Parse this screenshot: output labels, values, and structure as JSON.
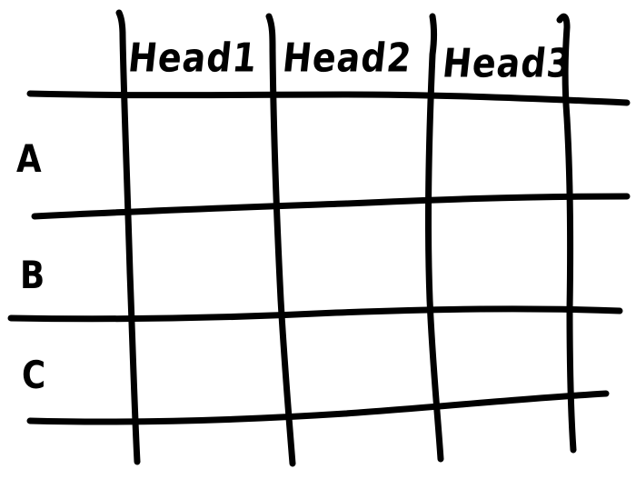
{
  "table": {
    "column_headers": [
      "Head1",
      "Head2",
      "Head3"
    ],
    "row_headers": [
      "A",
      "B",
      "C"
    ],
    "cells": [
      [
        "",
        "",
        ""
      ],
      [
        "",
        "",
        ""
      ],
      [
        "",
        "",
        ""
      ]
    ]
  },
  "ink_color": "#000000",
  "background_color": "#ffffff"
}
